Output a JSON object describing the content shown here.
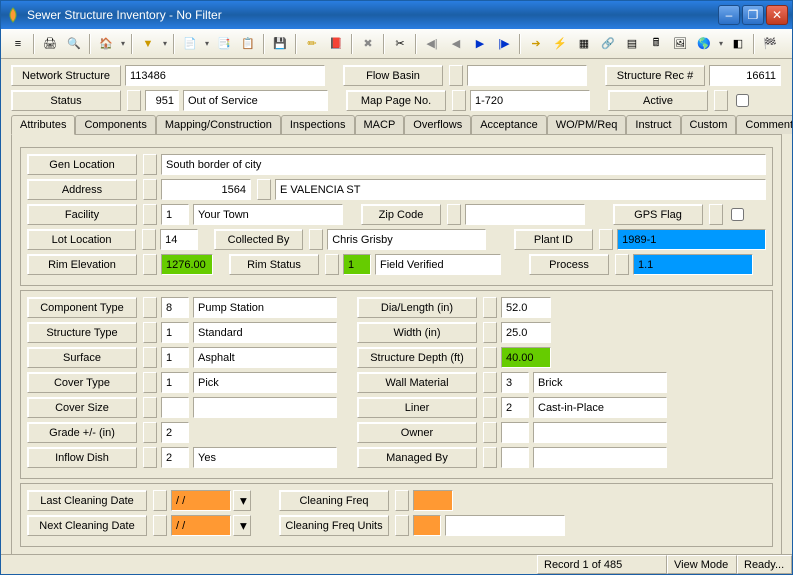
{
  "window": {
    "title": "Sewer Structure Inventory - No Filter"
  },
  "header": {
    "network_structure_label": "Network Structure",
    "network_structure_value": "113486",
    "flow_basin_label": "Flow Basin",
    "flow_basin_value": "",
    "structure_rec_label": "Structure Rec #",
    "structure_rec_value": "16611",
    "status_label": "Status",
    "status_code": "951",
    "status_text": "Out of Service",
    "map_page_label": "Map Page No.",
    "map_page_value": "1-720",
    "active_label": "Active"
  },
  "tabs": [
    "Attributes",
    "Components",
    "Mapping/Construction",
    "Inspections",
    "MACP",
    "Overflows",
    "Acceptance",
    "WO/PM/Req",
    "Instruct",
    "Custom",
    "Comments"
  ],
  "attr": {
    "gen_location_label": "Gen Location",
    "gen_location_value": "South border of city",
    "address_label": "Address",
    "address_num": "1564",
    "address_street": "E VALENCIA ST",
    "facility_label": "Facility",
    "facility_code": "1",
    "facility_name": "Your Town",
    "zip_label": "Zip Code",
    "zip_value": "",
    "gps_label": "GPS Flag",
    "lot_label": "Lot Location",
    "lot_value": "14",
    "collected_label": "Collected By",
    "collected_value": "Chris Grisby",
    "plant_label": "Plant ID",
    "plant_value": "1989-1",
    "rim_elev_label": "Rim Elevation",
    "rim_elev_value": "1276.00",
    "rim_status_label": "Rim Status",
    "rim_status_code": "1",
    "rim_status_text": "Field Verified",
    "process_label": "Process",
    "process_value": "1.1"
  },
  "comp": {
    "component_type_label": "Component Type",
    "component_type_code": "8",
    "component_type_text": "Pump Station",
    "structure_type_label": "Structure Type",
    "structure_type_code": "1",
    "structure_type_text": "Standard",
    "surface_label": "Surface",
    "surface_code": "1",
    "surface_text": "Asphalt",
    "cover_type_label": "Cover Type",
    "cover_type_code": "1",
    "cover_type_text": "Pick",
    "cover_size_label": "Cover Size",
    "cover_size_code": "",
    "cover_size_text": "",
    "grade_label": "Grade +/- (in)",
    "grade_code": "2",
    "inflow_label": "Inflow Dish",
    "inflow_code": "2",
    "inflow_text": "Yes",
    "dia_label": "Dia/Length (in)",
    "dia_value": "52.0",
    "width_label": "Width (in)",
    "width_value": "25.0",
    "depth_label": "Structure Depth (ft)",
    "depth_value": "40.00",
    "wall_label": "Wall Material",
    "wall_code": "3",
    "wall_text": "Brick",
    "liner_label": "Liner",
    "liner_code": "2",
    "liner_text": "Cast-in-Place",
    "owner_label": "Owner",
    "owner_code": "",
    "owner_text": "",
    "managed_label": "Managed By",
    "managed_code": "",
    "managed_text": ""
  },
  "clean": {
    "last_label": "Last Cleaning Date",
    "last_value": "  /  /",
    "next_label": "Next Cleaning Date",
    "next_value": "  /  /",
    "freq_label": "Cleaning Freq",
    "freq_value": "",
    "units_label": "Cleaning Freq Units",
    "units_code": "",
    "units_text": ""
  },
  "status": {
    "record": "Record 1 of 485",
    "view": "View Mode",
    "ready": "Ready..."
  },
  "icons": {
    "print": "🖨",
    "search": "🔍",
    "home": "🏠",
    "filter": "⌖",
    "doc": "📄",
    "copy": "📑",
    "paste": "📋",
    "save": "💾",
    "pencil": "✏",
    "book": "📕",
    "delete": "✖",
    "cut": "✂",
    "first": "◀",
    "prev": "◀",
    "next": "▶",
    "last": "▶",
    "arrow_r": "➔",
    "bolt": "⚡",
    "grid": "▦",
    "link": "🔗",
    "layers": "▤",
    "calc": "🖩",
    "image": "🖼",
    "globe": "🌎",
    "eraser": "◧",
    "flag": "🏁"
  }
}
